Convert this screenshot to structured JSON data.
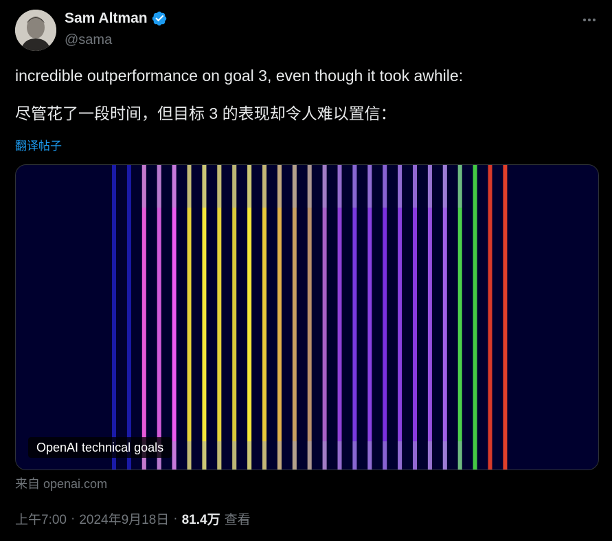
{
  "author": {
    "name": "Sam Altman",
    "handle": "@sama",
    "verified_color": "#1d9bf0"
  },
  "tweet": {
    "text_en": "incredible outperformance on goal 3, even though it took awhile:",
    "text_zh": "尽管花了一段时间，但目标 3 的表现却令人难以置信：",
    "translate_label": "翻译帖子"
  },
  "card": {
    "label": "OpenAI technical goals",
    "source": "来自 openai.com",
    "background": "#00002e",
    "icons": [
      "avatar",
      "verified-badge-icon",
      "more-options-icon"
    ],
    "stripe_colors": [
      "#1a1aa8",
      "#1a1aa8",
      "#e65ad8",
      "#d15ad8",
      "#ec5af0",
      "#e6d23a",
      "#f5e63a",
      "#e6d23a",
      "#d9c83a",
      "#f5e63a",
      "#e8c83a",
      "#e0b04a",
      "#c8a060",
      "#b8906a",
      "#a860c8",
      "#9040d8",
      "#7a3ae0",
      "#8840e0",
      "#7a30e0",
      "#8a40e0",
      "#8a3ae0",
      "#9850e0",
      "#a060e8",
      "#4cd04c",
      "#44c844",
      "#d83a2a",
      "#e0402a"
    ]
  },
  "meta": {
    "time": "上午7:00",
    "separator": "·",
    "date": "2024年9月18日",
    "views_count": "81.4万",
    "views_label": "查看"
  }
}
